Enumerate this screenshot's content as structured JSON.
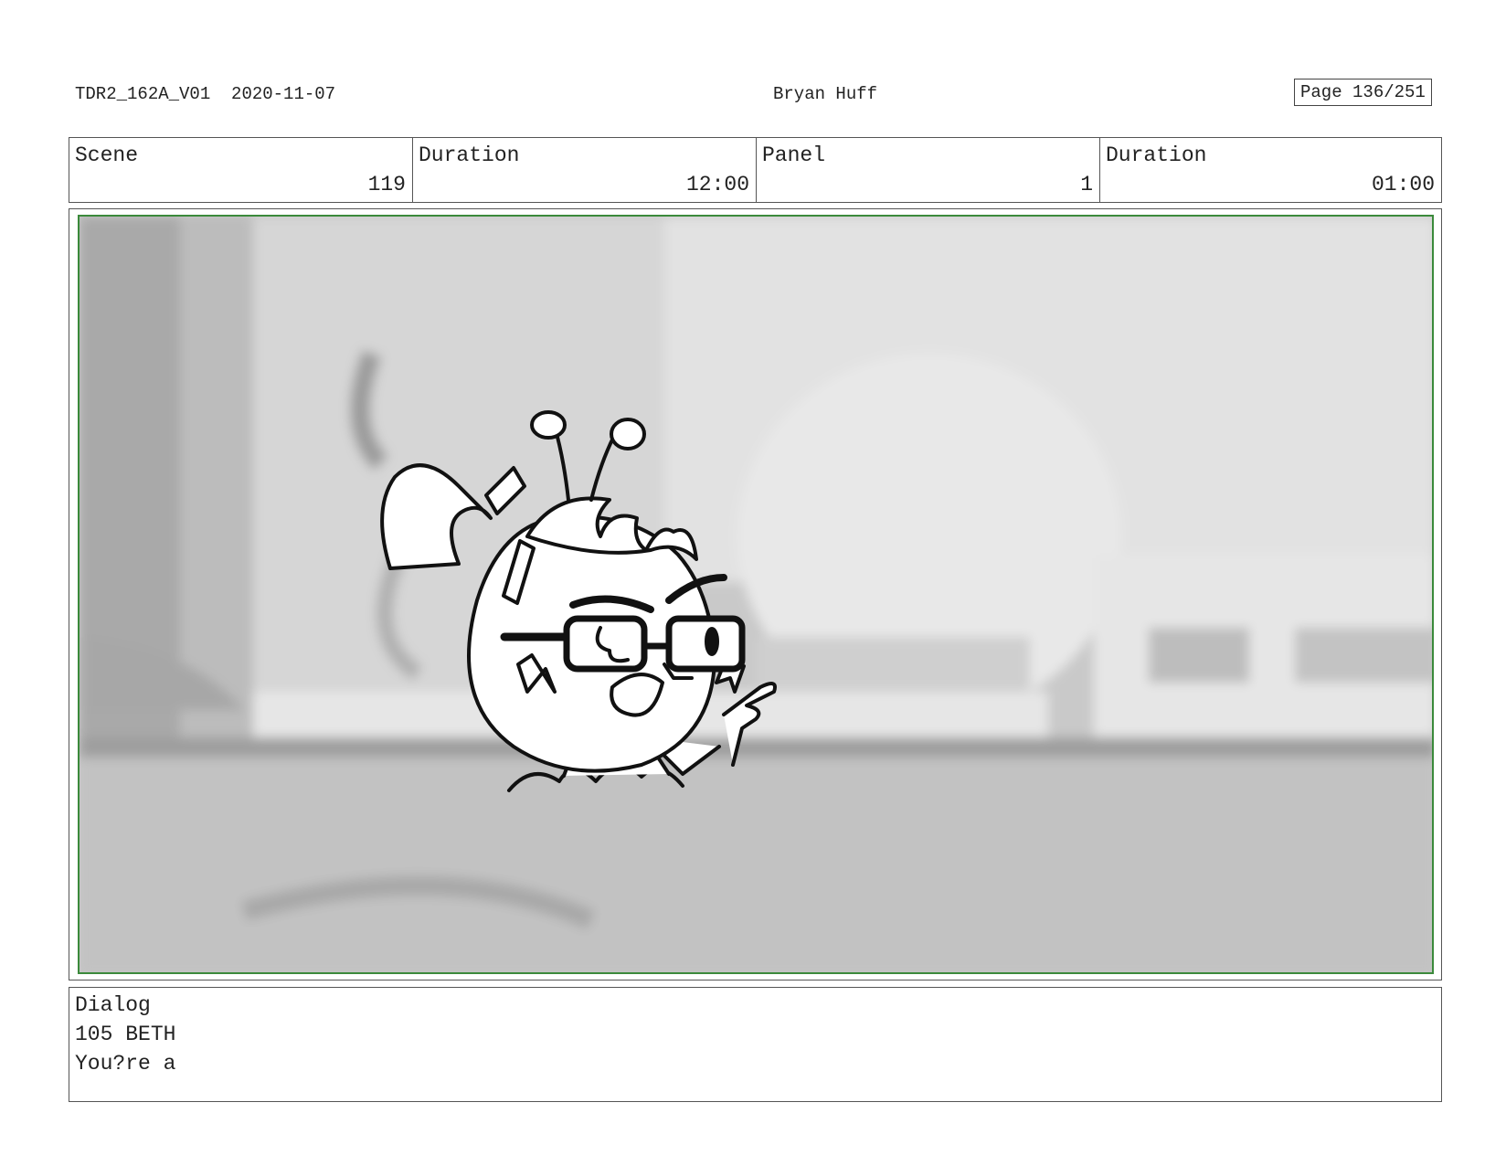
{
  "header": {
    "project": "TDR2_162A_V01",
    "date": "2020-11-07",
    "artist": "Bryan Huff",
    "page": "Page 136/251"
  },
  "info": {
    "scene_label": "Scene",
    "scene_value": "119",
    "scene_duration_label": "Duration",
    "scene_duration_value": "12:00",
    "panel_label": "Panel",
    "panel_value": "1",
    "panel_duration_label": "Duration",
    "panel_duration_value": "01:00"
  },
  "dialog": {
    "label": "Dialog",
    "line1": "105 BETH",
    "line2": "You?re a"
  }
}
